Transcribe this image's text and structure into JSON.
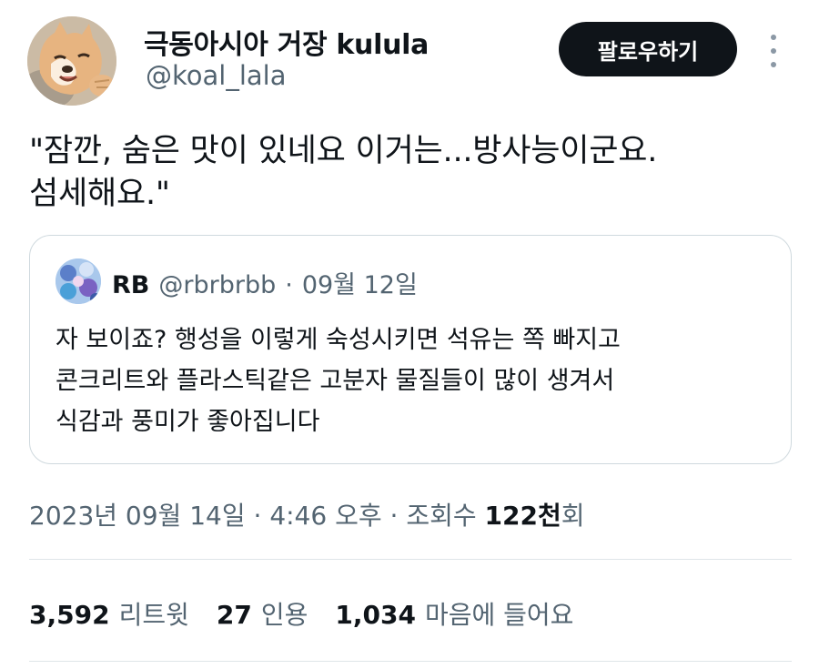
{
  "author": {
    "display_name": "극동아시아 거장 kulula",
    "handle": "@koal_lala",
    "avatar_icon": "dog-photo-avatar",
    "follow_label": "팔로우하기"
  },
  "tweet": {
    "lines": [
      "\"잠깐, 숨은 맛이 있네요 이거는...방사능이군요.",
      "섬세해요.\""
    ]
  },
  "quote": {
    "avatar_icon": "blue-pattern-avatar",
    "name": "RB",
    "handle": "@rbrbrbb",
    "separator": "·",
    "date": "09월 12일",
    "lines": [
      "자 보이죠? 행성을 이렇게 숙성시키면 석유는 쪽 빠지고",
      "콘크리트와 플라스틱같은 고분자 물질들이 많이 생겨서",
      "식감과 풍미가 좋아집니다"
    ]
  },
  "meta": {
    "date": "2023년 09월 14일",
    "sep1": " · ",
    "time": "4:46 오후",
    "sep2": " · ",
    "views_label": "조회수 ",
    "views_count": "122천",
    "views_suffix": "회"
  },
  "stats": {
    "retweets_count": "3,592",
    "retweets_label": "리트윗",
    "quotes_count": "27",
    "quotes_label": "인용",
    "likes_count": "1,034",
    "likes_label": "마음에 들어요"
  },
  "colors": {
    "text": "#0f1419",
    "secondary": "#536471",
    "border": "#cfd9de",
    "button": "#0f1419"
  }
}
